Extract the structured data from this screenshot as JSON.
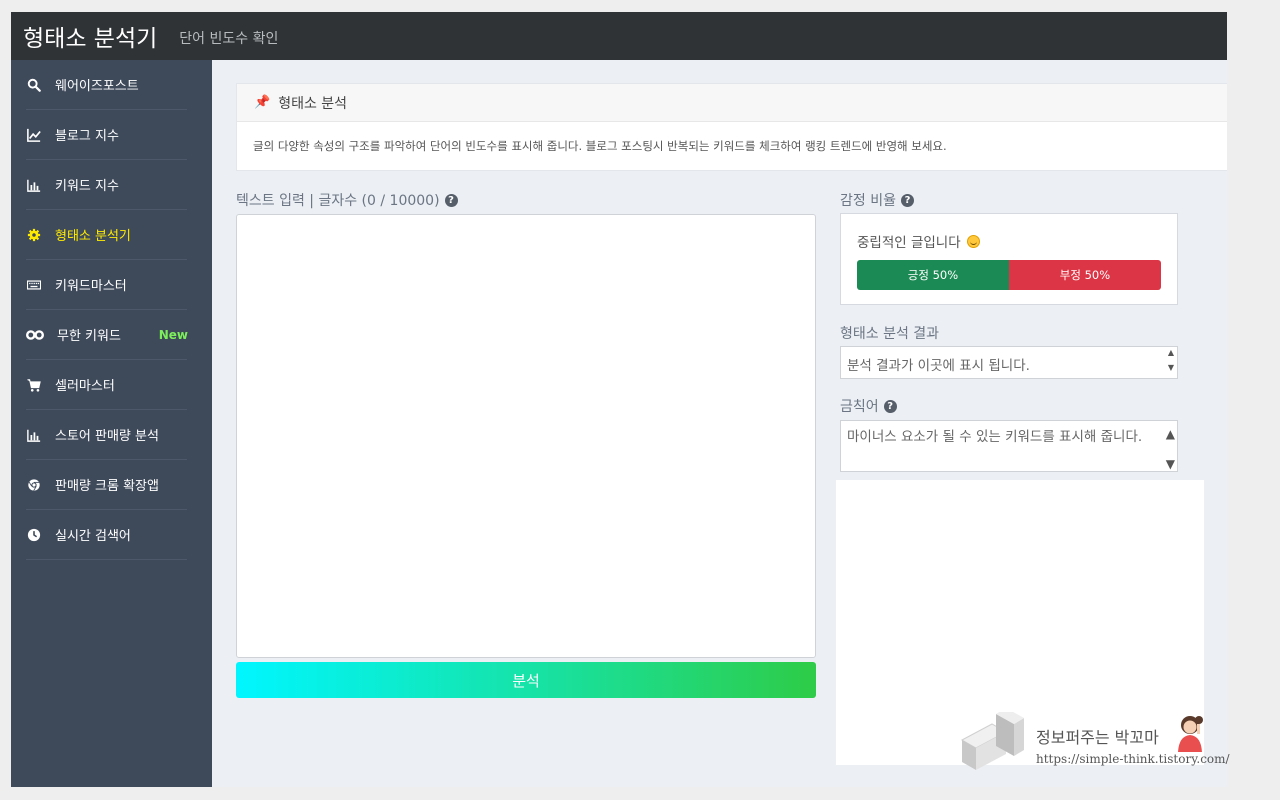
{
  "header": {
    "title": "형태소 분석기",
    "subtitle": "단어 빈도수 확인"
  },
  "sidebar": {
    "items": [
      {
        "label": "웨어이즈포스트",
        "icon": "search-icon"
      },
      {
        "label": "블로그 지수",
        "icon": "line-chart-icon"
      },
      {
        "label": "키워드 지수",
        "icon": "bar-chart-icon"
      },
      {
        "label": "형태소 분석기",
        "icon": "gear-icon",
        "active": true
      },
      {
        "label": "키워드마스터",
        "icon": "keyboard-icon"
      },
      {
        "label": "무한 키워드",
        "icon": "infinity-icon",
        "badge": "New"
      },
      {
        "label": "셀러마스터",
        "icon": "cart-icon"
      },
      {
        "label": "스토어 판매량 분석",
        "icon": "bar-chart-icon"
      },
      {
        "label": "판매량 크롬 확장앱",
        "icon": "chrome-icon"
      },
      {
        "label": "실시간 검색어",
        "icon": "clock-icon"
      }
    ]
  },
  "info": {
    "title": "형태소 분석",
    "description": "글의 다양한 속성의 구조를 파악하여 단어의 빈도수를 표시해 줍니다. 블로그 포스팅시 반복되는 키워드를 체크하여 랭킹 트렌드에 반영해 보세요."
  },
  "text_input": {
    "label": "텍스트 입력 | 글자수 (0 / 10000)",
    "value": ""
  },
  "analyze_button": "분석",
  "sentiment": {
    "label": "감정 비율",
    "message": "중립적인 글입니다",
    "positive": "긍정 50%",
    "negative": "부정 50%",
    "positive_ratio": 0.5
  },
  "morph_result": {
    "label": "형태소 분석 결과",
    "placeholder": "분석 결과가 이곳에 표시 됩니다."
  },
  "banned": {
    "label": "금칙어",
    "placeholder": "마이너스 요소가 될 수 있는 키워드를 표시해 줍니다."
  },
  "watermark": {
    "title": "정보퍼주는 박꼬마",
    "url": "https://simple-think.tistory.com/"
  },
  "colors": {
    "topbar": "#2f3336",
    "sidebar": "#3e495a",
    "active": "#ffeb00",
    "positive": "#1c8a54",
    "negative": "#dc3545",
    "new_badge": "#7cf05a"
  }
}
